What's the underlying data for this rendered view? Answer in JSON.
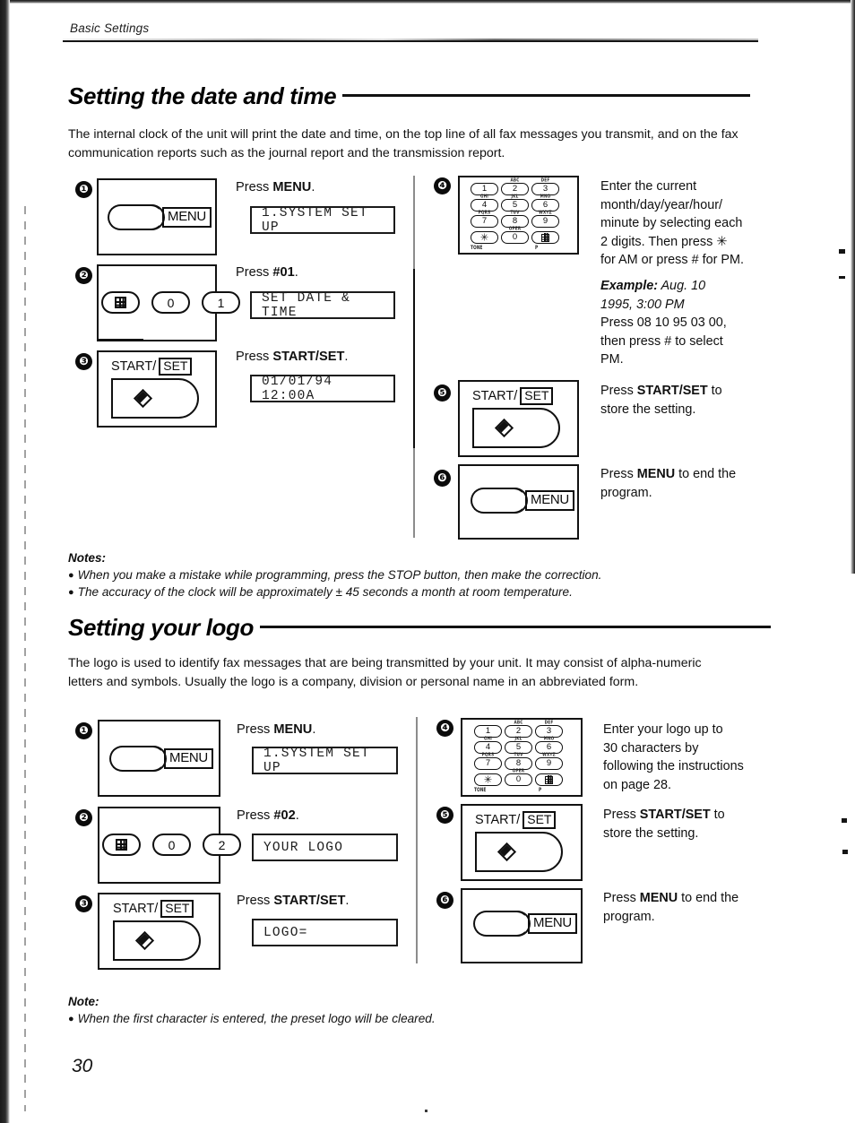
{
  "header": {
    "running_title": "Basic Settings"
  },
  "page_number": "30",
  "sections": [
    {
      "title": "Setting the date and time",
      "intro": "The internal clock of the unit will print the date and time, on the top line of all fax messages you transmit, and on the fax communication reports such as the journal report and the transmission report.",
      "steps_left": [
        {
          "num": "❶",
          "instruction_prefix": "Press ",
          "instruction_bold": "MENU",
          "instruction_suffix": ".",
          "lcd": "1.SYSTEM SET UP",
          "device": "menu-button",
          "menu_label": "MENU"
        },
        {
          "num": "❷",
          "instruction_prefix": "Press ",
          "instruction_bold": "#01",
          "instruction_suffix": ".",
          "lcd": "SET DATE & TIME",
          "device": "key-row",
          "keys": [
            "#",
            "0",
            "1"
          ]
        },
        {
          "num": "❸",
          "instruction_prefix": "Press ",
          "instruction_bold": "START/SET",
          "instruction_suffix": ".",
          "lcd": "01/01/94 12:00A",
          "device": "start-set",
          "start_label": "START/",
          "set_label": "SET"
        }
      ],
      "steps_right": [
        {
          "num": "❹",
          "device": "keypad",
          "text_line1": "Enter the current",
          "text_line2": "month/day/year/hour/",
          "text_line3": "minute by selecting each",
          "text_line4": "2 digits. Then press ✳",
          "text_line5": "for AM or press # for PM.",
          "example_label": "Example:",
          "example_line1": " Aug. 10",
          "example_line2": "1995, 3:00 PM",
          "example_line3": "Press 08 10 95 03 00,",
          "example_line4": "then press # to select",
          "example_line5": "PM."
        },
        {
          "num": "❺",
          "device": "start-set",
          "start_label": "START/",
          "set_label": "SET",
          "text_line1": "Press START/SET to",
          "text_line2": "store the setting.",
          "bold_token": "START/SET"
        },
        {
          "num": "❻",
          "device": "menu-button",
          "menu_label": "MENU",
          "text_line1": "Press MENU to end the",
          "text_line2": "program.",
          "bold_token": "MENU"
        }
      ],
      "notes_title": "Notes:",
      "notes": [
        "When you make a mistake while programming, press the STOP button, then make the correction.",
        "The accuracy of the clock will be approximately ± 45 seconds a month at room temperature."
      ]
    },
    {
      "title": "Setting your logo",
      "intro": "The logo is used to identify fax messages that are being transmitted by your unit. It may consist of alpha-numeric letters and symbols. Usually the logo is a company, division or personal name in an abbreviated form.",
      "steps_left": [
        {
          "num": "❶",
          "instruction_prefix": "Press ",
          "instruction_bold": "MENU",
          "instruction_suffix": ".",
          "lcd": "1.SYSTEM SET UP",
          "device": "menu-button",
          "menu_label": "MENU"
        },
        {
          "num": "❷",
          "instruction_prefix": "Press ",
          "instruction_bold": "#02",
          "instruction_suffix": ".",
          "lcd": "YOUR LOGO",
          "device": "key-row",
          "keys": [
            "#",
            "0",
            "2"
          ]
        },
        {
          "num": "❸",
          "instruction_prefix": "Press ",
          "instruction_bold": "START/SET",
          "instruction_suffix": ".",
          "lcd": "LOGO=",
          "device": "start-set",
          "start_label": "START/",
          "set_label": "SET"
        }
      ],
      "steps_right": [
        {
          "num": "❹",
          "device": "keypad",
          "text_line1": "Enter your logo up to",
          "text_line2": "30 characters by",
          "text_line3": "following the instructions",
          "text_line4": "on page 28."
        },
        {
          "num": "❺",
          "device": "start-set",
          "start_label": "START/",
          "set_label": "SET",
          "text_line1": "Press START/SET to",
          "text_line2": "store the setting.",
          "bold_token": "START/SET"
        },
        {
          "num": "❻",
          "device": "menu-button",
          "menu_label": "MENU",
          "text_line1": "Press MENU to end the",
          "text_line2": "program.",
          "bold_token": "MENU"
        }
      ],
      "notes_title": "Note:",
      "notes": [
        "When the first character is entered, the preset logo will be cleared."
      ]
    }
  ],
  "keypad": {
    "keys": [
      "1",
      "2",
      "3",
      "4",
      "5",
      "6",
      "7",
      "8",
      "9",
      "✳",
      "0",
      "#"
    ],
    "sublabels": [
      "",
      "ABC",
      "DEF",
      "GHI",
      "JKL",
      "MNO",
      "PQRS",
      "TUV",
      "WXYZ",
      "",
      "OPER",
      ""
    ],
    "foot_left": "TONE",
    "foot_right": "P"
  },
  "colors": {
    "ink": "#111111",
    "paper": "#ffffff"
  }
}
